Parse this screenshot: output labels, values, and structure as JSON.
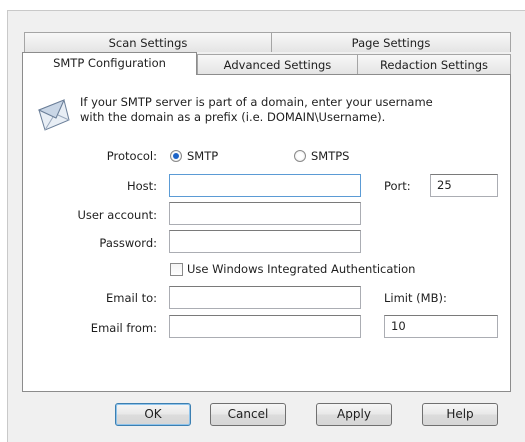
{
  "tabs": {
    "row_back": [
      "Scan Settings",
      "Page Settings"
    ],
    "row_front": [
      "SMTP Configuration",
      "Advanced Settings",
      "Redaction Settings"
    ],
    "active": "SMTP Configuration"
  },
  "info": {
    "icon": "email-envelope-icon",
    "line1": "If your SMTP server is part of a domain, enter your username",
    "line2": "with the domain as a prefix (i.e. DOMAIN\\Username)."
  },
  "form": {
    "protocol_label": "Protocol:",
    "protocol_options": [
      "SMTP",
      "SMTPS"
    ],
    "protocol_selected": "SMTP",
    "host_label": "Host:",
    "host_value": "",
    "port_label": "Port:",
    "port_value": "25",
    "user_label": "User account:",
    "user_value": "",
    "password_label": "Password:",
    "password_value": "",
    "windows_auth_label": "Use Windows Integrated Authentication",
    "windows_auth_checked": false,
    "email_to_label": "Email to:",
    "email_to_value": "",
    "limit_label": "Limit (MB):",
    "limit_value": "10",
    "email_from_label": "Email from:",
    "email_from_value": ""
  },
  "buttons": {
    "ok": "OK",
    "cancel": "Cancel",
    "apply": "Apply",
    "help": "Help"
  },
  "colors": {
    "panel": "#ffffff",
    "frame": "#f0f0f0",
    "radio_dot": "#1c63c7",
    "default_button_border": "#3c7fb1"
  }
}
